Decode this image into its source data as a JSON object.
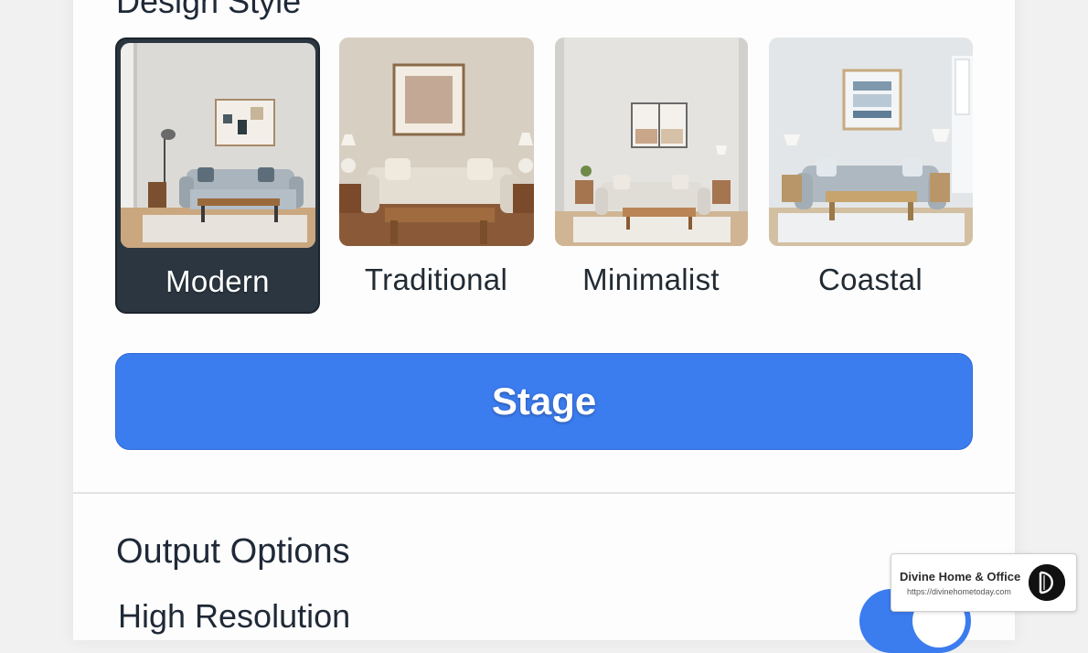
{
  "section": {
    "title": "Design Style"
  },
  "styles": [
    {
      "label": "Modern",
      "selected": true
    },
    {
      "label": "Traditional",
      "selected": false
    },
    {
      "label": "Minimalist",
      "selected": false
    },
    {
      "label": "Coastal",
      "selected": false
    }
  ],
  "stage_button": {
    "label": "Stage"
  },
  "output": {
    "title": "Output Options",
    "option_label": "High Resolution",
    "high_resolution_enabled": true
  },
  "watermark": {
    "name": "Divine Home & Office",
    "url": "https://divinehometoday.com"
  },
  "colors": {
    "accent": "#3b7cef",
    "selected_card": "#2c3640",
    "text": "#1f2937"
  }
}
